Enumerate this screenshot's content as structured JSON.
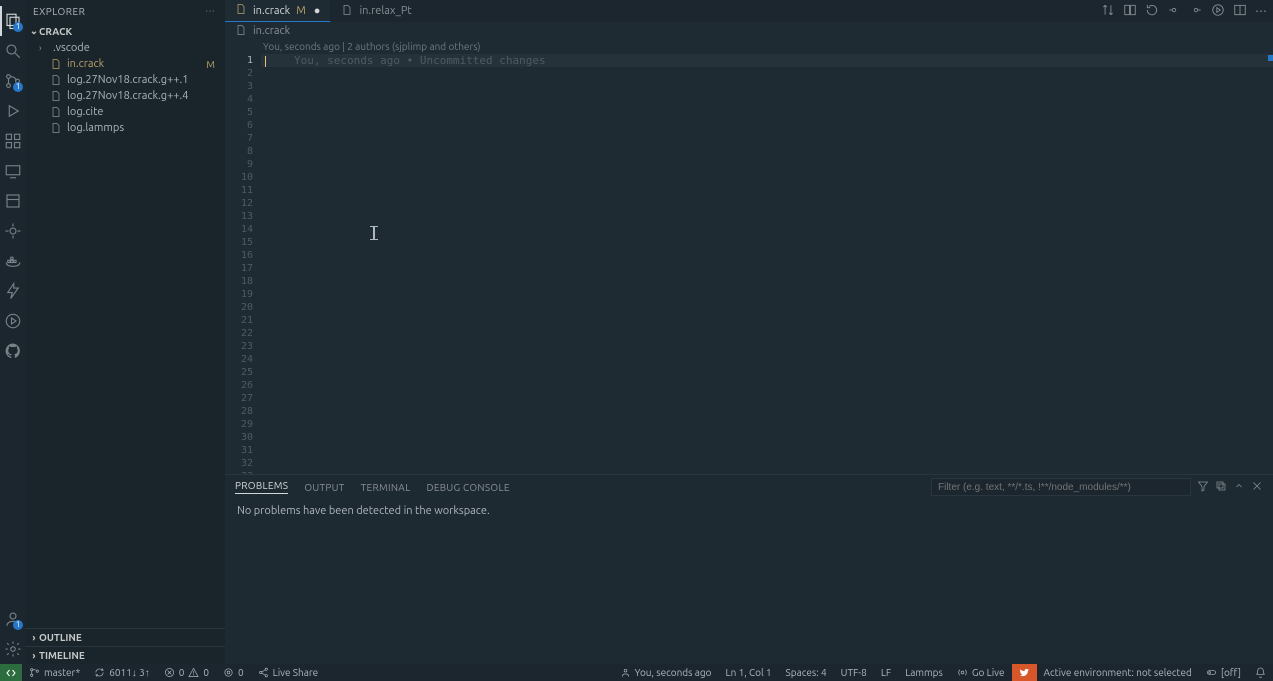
{
  "sidebar": {
    "title": "EXPLORER",
    "project": "CRACK",
    "items": [
      {
        "name": ".vscode",
        "folder": true
      },
      {
        "name": "in.crack",
        "modified": true
      },
      {
        "name": "log.27Nov18.crack.g++.1"
      },
      {
        "name": "log.27Nov18.crack.g++.4"
      },
      {
        "name": "log.cite"
      },
      {
        "name": "log.lammps"
      }
    ],
    "outline": "OUTLINE",
    "timeline": "TIMELINE"
  },
  "tabs": [
    {
      "label": "in.crack",
      "modified_marker": "M",
      "active": true,
      "dirty": true
    },
    {
      "label": "in.relax_Pt"
    }
  ],
  "breadcrumb": {
    "file": "in.crack"
  },
  "codelens": "You, seconds ago | 2 authors (sjplimp and others)",
  "editor": {
    "ghost": "You, seconds ago • Uncommitted changes"
  },
  "panel": {
    "tabs": {
      "problems": "PROBLEMS",
      "output": "OUTPUT",
      "terminal": "TERMINAL",
      "debug": "DEBUG CONSOLE"
    },
    "filter_placeholder": "Filter (e.g. text, **/*.ts, !**/node_modules/**)",
    "message": "No problems have been detected in the workspace."
  },
  "status": {
    "branch": "master*",
    "sync": "6011↓ 3↑",
    "errors": "0",
    "warnings": "0",
    "ports": "0",
    "live_share": "Live Share",
    "blame": "You, seconds ago",
    "position": "Ln 1, Col 1",
    "spaces": "Spaces: 4",
    "encoding": "UTF-8",
    "eol": "LF",
    "language": "Lammps",
    "go_live": "Go Live",
    "environment": "Active environment: not selected",
    "toggle": "[off]"
  },
  "activity_badge": "1",
  "scm_badge": "1"
}
